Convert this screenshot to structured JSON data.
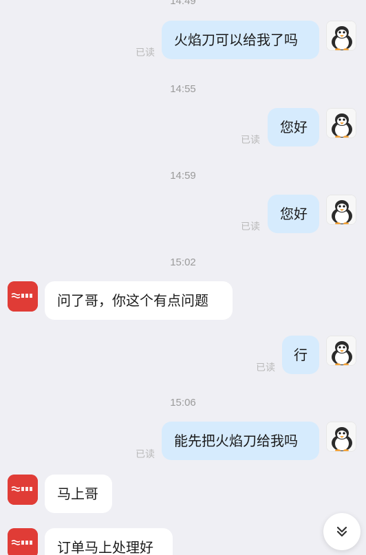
{
  "timestamps": [
    "14:49",
    "14:55",
    "14:59",
    "15:02",
    "15:06"
  ],
  "read_label": "已读",
  "messages": [
    {
      "sender": "me",
      "text": "火焰刀可以给我了吗"
    },
    {
      "sender": "me",
      "text": "您好"
    },
    {
      "sender": "me",
      "text": "您好"
    },
    {
      "sender": "shop",
      "text": "问了哥，你这个有点问题"
    },
    {
      "sender": "me",
      "text": "行"
    },
    {
      "sender": "me",
      "text": "能先把火焰刀给我吗"
    },
    {
      "sender": "shop",
      "text": "马上哥"
    },
    {
      "sender": "shop",
      "text": "订单马上处理好"
    }
  ],
  "icons": {
    "my_avatar": "penguin-avatar-icon",
    "shop_avatar": "shop-logo-icon",
    "scroll": "double-chevron-down-icon"
  },
  "colors": {
    "background": "#efeff4",
    "my_bubble": "#d6ebfd",
    "their_bubble": "#ffffff",
    "shop_logo": "#e03c36"
  }
}
